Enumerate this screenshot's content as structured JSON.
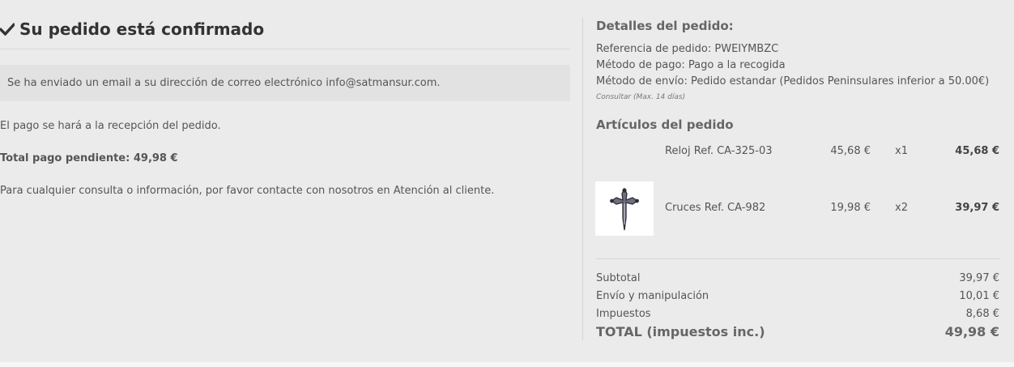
{
  "confirmation": {
    "title": "Su pedido está confirmado",
    "email_notice": "Se ha enviado un email a su dirección de correo electrónico info@satmansur.com.",
    "payment_note": "El pago se hará a la recepción del pedido.",
    "pending_total": "Total pago pendiente: 49,98 €",
    "contact_note": "Para cualquier consulta o información, por favor contacte con nosotros en Atención al cliente."
  },
  "details": {
    "heading": "Detalles del pedido:",
    "reference": "Referencia de pedido: PWEIYMBZC",
    "payment_method": "Método de pago: Pago a la recogida",
    "shipping_method": "Método de envío: Pedido estandar (Pedidos Peninsulares inferior a 50.00€)",
    "shipping_note": "Consultar (Max. 14 días)"
  },
  "items": {
    "heading": "Artículos del pedido",
    "rows": [
      {
        "name": "Reloj Ref. CA-325-03",
        "unit_price": "45,68 €",
        "qty": "x1",
        "total": "45,68 €",
        "image": "none"
      },
      {
        "name": "Cruces Ref. CA-982",
        "unit_price": "19,98 €",
        "qty": "x2",
        "total": "39,97 €",
        "image": "cross-of-saint-james-pendant"
      }
    ]
  },
  "summary": {
    "subtotal_label": "Subtotal",
    "subtotal_value": "39,97 €",
    "shipping_label": "Envío y manipulación",
    "shipping_value": "10,01 €",
    "taxes_label": "Impuestos",
    "taxes_value": "8,68 €",
    "total_label": "TOTAL (impuestos inc.)",
    "total_value": "49,98 €"
  },
  "colors": {
    "background": "#ebebeb",
    "notice_bg": "#e2e2e2",
    "text": "#5a5a5a"
  },
  "icons": {
    "title_icon": "check-icon"
  }
}
